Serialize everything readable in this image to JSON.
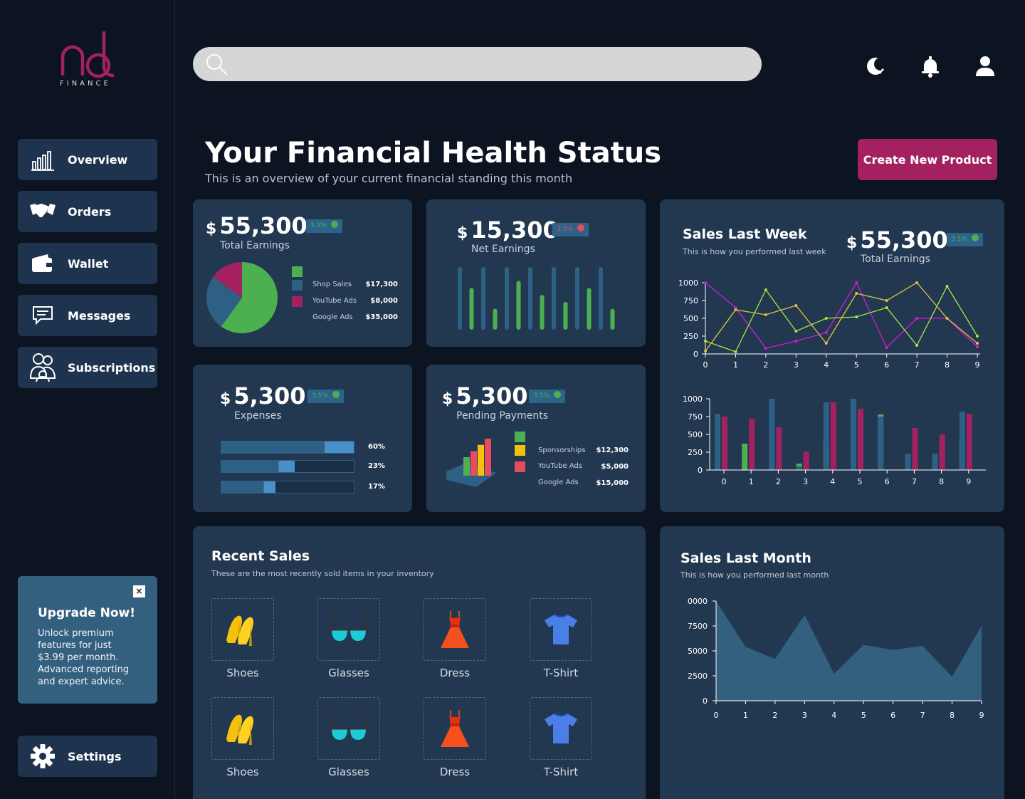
{
  "brand": {
    "name": "FINANCE",
    "color": "#a3215f"
  },
  "search": {
    "placeholder": "",
    "value": ""
  },
  "sidebar": {
    "items": [
      {
        "label": "Overview",
        "icon": "bar-chart-icon"
      },
      {
        "label": "Orders",
        "icon": "handshake-icon"
      },
      {
        "label": "Wallet",
        "icon": "wallet-icon"
      },
      {
        "label": "Messages",
        "icon": "message-icon"
      },
      {
        "label": "Subscriptions",
        "icon": "users-icon"
      }
    ],
    "settings_label": "Settings"
  },
  "upgrade": {
    "title": "Upgrade Now!",
    "text": "Unlock premium features for just $3.99 per month. Advanced reporting and expert advice.",
    "close": "×"
  },
  "header": {
    "title": "Your Financial Health Status",
    "subtitle": "This is an overview of your current financial standing this month",
    "create_button": "Create New Product"
  },
  "colors": {
    "green": "#4caf50",
    "blue": "#2e5f85",
    "magenta": "#a3215f",
    "yellow": "#f4c20d",
    "red": "#e84a5f",
    "purple": "#d619d6",
    "lime": "#a4ea3b",
    "gold": "#e2c23a"
  },
  "cards": {
    "total_earnings": {
      "currency": "$",
      "amount": "55,300",
      "label": "Total Earnings",
      "badge": "3.5%",
      "legend": [
        {
          "label": "",
          "value": "",
          "color": "#4caf50"
        },
        {
          "label": "Shop Sales",
          "value": "$17,300",
          "color": "#2e5f85"
        },
        {
          "label": "YouTube Ads",
          "value": "$8,000",
          "color": "#a3215f"
        },
        {
          "label": "Google Ads",
          "value": "$35,000",
          "color": ""
        }
      ]
    },
    "net_earnings": {
      "currency": "$",
      "amount": "15,300",
      "label": "Net Earnings",
      "badge": "3.5%"
    },
    "expenses": {
      "currency": "$",
      "amount": "5,300",
      "label": "Expenses",
      "badge": "3.5%",
      "bars": [
        {
          "percent": 60,
          "label": "60%"
        },
        {
          "percent": 23,
          "label": "23%"
        },
        {
          "percent": 17,
          "label": "17%"
        }
      ]
    },
    "pending": {
      "currency": "$",
      "amount": "5,300",
      "label": "Pending Payments",
      "badge": "3.5%",
      "legend": [
        {
          "label": "",
          "value": "",
          "color": "#4caf50"
        },
        {
          "label": "Sponsorships",
          "value": "$12,300",
          "color": "#f4c20d"
        },
        {
          "label": "YouTube Ads",
          "value": "$5,000",
          "color": "#e84a5f"
        },
        {
          "label": "Google Ads",
          "value": "$15,000",
          "color": ""
        }
      ]
    },
    "sales_last_week": {
      "title": "Sales Last Week",
      "subtitle": "This  is how you performed last week",
      "currency": "$",
      "amount": "55,300",
      "label": "Total Earnings",
      "badge": "3.5%"
    },
    "sales_last_month": {
      "title": "Sales Last Month",
      "subtitle": "This  is how you performed last month"
    },
    "recent_sales": {
      "title": "Recent Sales",
      "subtitle": "These are the most recently sold items in your inventory",
      "items": [
        {
          "label": "Shoes",
          "icon": "heels-icon"
        },
        {
          "label": "Glasses",
          "icon": "sunglasses-icon"
        },
        {
          "label": "Dress",
          "icon": "dress-icon"
        },
        {
          "label": "T-Shirt",
          "icon": "tshirt-icon"
        },
        {
          "label": "Shoes",
          "icon": "heels-icon"
        },
        {
          "label": "Glasses",
          "icon": "sunglasses-icon"
        },
        {
          "label": "Dress",
          "icon": "dress-icon"
        },
        {
          "label": "T-Shirt",
          "icon": "tshirt-icon"
        }
      ]
    }
  },
  "chart_data": [
    {
      "id": "earnings-pie",
      "type": "pie",
      "slices": [
        {
          "value": 60,
          "color": "#4caf50"
        },
        {
          "value": 25,
          "color": "#2e5f85"
        },
        {
          "value": 15,
          "color": "#a3215f"
        }
      ]
    },
    {
      "id": "net-earnings-bars",
      "type": "bar",
      "values": [
        9,
        6,
        9,
        3,
        9,
        7,
        9,
        5,
        9,
        4,
        9,
        6,
        9,
        3
      ],
      "colors": [
        "#2e5f85",
        "#4caf50"
      ]
    },
    {
      "id": "pending-bars",
      "type": "bar",
      "values": [
        3,
        4,
        5,
        6
      ],
      "colors": [
        "#4caf50",
        "#e84a5f",
        "#f4c20d",
        "#e84a5f"
      ]
    },
    {
      "id": "week-line",
      "type": "line",
      "x": [
        0,
        1,
        2,
        3,
        4,
        5,
        6,
        7,
        8,
        9
      ],
      "xlim": [
        0,
        9
      ],
      "ylim": [
        0,
        1000
      ],
      "yticks": [
        0,
        250,
        500,
        750,
        1000
      ],
      "series": [
        {
          "color": "#d619d6",
          "values": [
            1000,
            650,
            80,
            180,
            300,
            1000,
            90,
            500,
            500,
            100
          ]
        },
        {
          "color": "#a4ea3b",
          "values": [
            180,
            30,
            900,
            320,
            500,
            520,
            650,
            120,
            950,
            250
          ]
        },
        {
          "color": "#e2c23a",
          "values": [
            40,
            620,
            550,
            680,
            150,
            850,
            750,
            1000,
            500,
            150
          ]
        }
      ]
    },
    {
      "id": "week-bars",
      "type": "bar",
      "categories": [
        "0",
        "1",
        "2",
        "3",
        "4",
        "5",
        "6",
        "7",
        "8",
        "9"
      ],
      "ylim": [
        0,
        1000
      ],
      "yticks": [
        0,
        250,
        500,
        750,
        1000
      ],
      "series": [
        {
          "color": "#4caf50",
          "values": [
            520,
            370,
            270,
            90,
            390,
            500,
            780,
            0,
            40,
            440
          ]
        },
        {
          "color": "#a3215f",
          "values": [
            750,
            720,
            600,
            260,
            950,
            860,
            0,
            590,
            500,
            790
          ]
        },
        {
          "color": "#2e5f85",
          "values": [
            790,
            0,
            1000,
            50,
            950,
            1000,
            750,
            230,
            230,
            820
          ]
        }
      ]
    },
    {
      "id": "month-area",
      "type": "area",
      "x": [
        0,
        1,
        2,
        3,
        4,
        5,
        6,
        7,
        8,
        9
      ],
      "ylim": [
        0,
        10000
      ],
      "yticks": [
        0,
        2500,
        5000,
        7500,
        10000
      ],
      "tick_labels": [
        "0",
        "2500",
        "5000",
        "7500",
        "0000"
      ],
      "values": [
        10000,
        5400,
        4200,
        8600,
        2700,
        5600,
        5100,
        5500,
        2400,
        7500
      ],
      "color": "#34607f"
    }
  ]
}
